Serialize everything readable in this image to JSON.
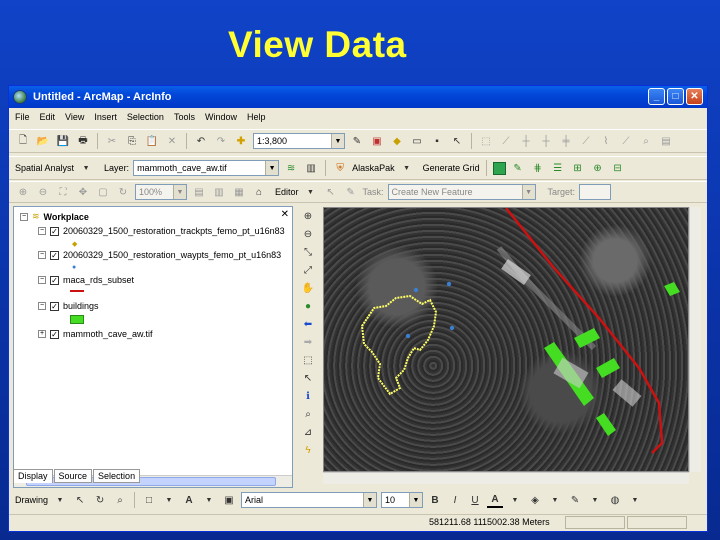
{
  "slide": {
    "title": "View Data"
  },
  "window": {
    "title": "Untitled - ArcMap - ArcInfo",
    "buttons": {
      "minimize": "_",
      "maximize": "□",
      "close": "✕"
    }
  },
  "menu": [
    "File",
    "Edit",
    "View",
    "Insert",
    "Selection",
    "Tools",
    "Window",
    "Help"
  ],
  "standard_toolbar": {
    "scale": "1:3,800"
  },
  "spatial_analyst": {
    "label": "Spatial Analyst",
    "layer_label": "Layer:",
    "layer_value": "mammoth_cave_aw.tif",
    "alaskapak": "AlaskaPak",
    "generate_grid": "Generate Grid"
  },
  "editor_toolbar": {
    "zoom": "100%",
    "editor": "Editor",
    "task_label": "Task:",
    "task_value": "Create New Feature",
    "target_label": "Target:"
  },
  "toc": {
    "root": "Workplace",
    "layers": [
      {
        "name": "20060329_1500_restoration_trackpts_femo_pt_u16n83",
        "checked": true
      },
      {
        "name": "20060329_1500_restoration_waypts_femo_pt_u16n83",
        "checked": true
      },
      {
        "name": "maca_rds_subset",
        "checked": true
      },
      {
        "name": "buildings",
        "checked": true
      },
      {
        "name": "mammoth_cave_aw.tif",
        "checked": true
      }
    ],
    "tabs": [
      "Display",
      "Source",
      "Selection"
    ]
  },
  "drawing_toolbar": {
    "label": "Drawing",
    "font": "Arial",
    "size": "10"
  },
  "status": {
    "coords": "581211.68  1115002.38 Meters"
  },
  "colors": {
    "title_yellow": "#ffff33",
    "slide_blue": "#0a33a8",
    "road": "#cc1111",
    "buildings": "#44dd22",
    "boundary": "#ffff66",
    "waypoint": "#3a7fd0"
  }
}
